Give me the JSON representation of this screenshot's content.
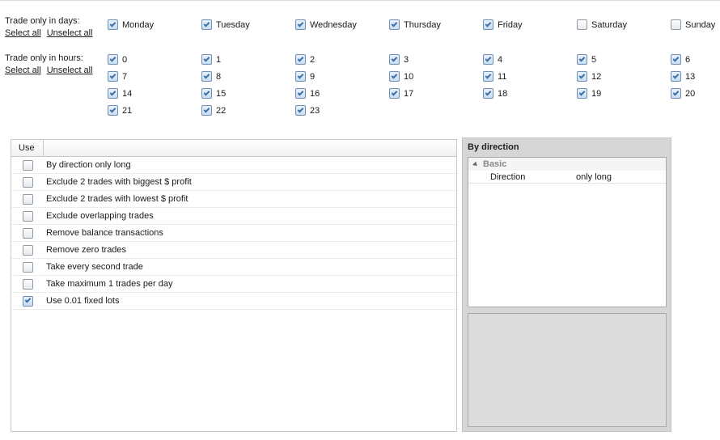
{
  "days": {
    "label": "Trade only in days:",
    "select_all": "Select all",
    "unselect_all": "Unselect all",
    "items": [
      {
        "label": "Monday",
        "checked": true
      },
      {
        "label": "Tuesday",
        "checked": true
      },
      {
        "label": "Wednesday",
        "checked": true
      },
      {
        "label": "Thursday",
        "checked": true
      },
      {
        "label": "Friday",
        "checked": true
      },
      {
        "label": "Saturday",
        "checked": false
      },
      {
        "label": "Sunday",
        "checked": false
      }
    ]
  },
  "hours": {
    "label": "Trade only in hours:",
    "select_all": "Select all",
    "unselect_all": "Unselect all",
    "items": [
      {
        "label": "0",
        "checked": true
      },
      {
        "label": "1",
        "checked": true
      },
      {
        "label": "2",
        "checked": true
      },
      {
        "label": "3",
        "checked": true
      },
      {
        "label": "4",
        "checked": true
      },
      {
        "label": "5",
        "checked": true
      },
      {
        "label": "6",
        "checked": true
      },
      {
        "label": "7",
        "checked": true
      },
      {
        "label": "8",
        "checked": true
      },
      {
        "label": "9",
        "checked": true
      },
      {
        "label": "10",
        "checked": true
      },
      {
        "label": "11",
        "checked": true
      },
      {
        "label": "12",
        "checked": true
      },
      {
        "label": "13",
        "checked": true
      },
      {
        "label": "14",
        "checked": true
      },
      {
        "label": "15",
        "checked": true
      },
      {
        "label": "16",
        "checked": true
      },
      {
        "label": "17",
        "checked": true
      },
      {
        "label": "18",
        "checked": true
      },
      {
        "label": "19",
        "checked": true
      },
      {
        "label": "20",
        "checked": true
      },
      {
        "label": "21",
        "checked": true
      },
      {
        "label": "22",
        "checked": true
      },
      {
        "label": "23",
        "checked": true
      }
    ]
  },
  "filters_table": {
    "columns": [
      "Use",
      ""
    ],
    "rows": [
      {
        "name": "By direction only long",
        "use": false
      },
      {
        "name": "Exclude 2 trades with biggest $ profit",
        "use": false
      },
      {
        "name": "Exclude 2 trades with lowest $ profit",
        "use": false
      },
      {
        "name": "Exclude overlapping trades",
        "use": false
      },
      {
        "name": "Remove balance transactions",
        "use": false
      },
      {
        "name": "Remove zero trades",
        "use": false
      },
      {
        "name": "Take every second trade",
        "use": false
      },
      {
        "name": "Take maximum 1 trades per day",
        "use": false
      },
      {
        "name": "Use 0.01 fixed lots",
        "use": true
      }
    ]
  },
  "properties": {
    "title": "By direction",
    "category": "Basic",
    "rows": [
      {
        "name": "Direction",
        "value": "only long"
      }
    ]
  },
  "colors": {
    "checkbox_tick": "#3c6ea6",
    "panel_bg": "#d6d6d6"
  }
}
